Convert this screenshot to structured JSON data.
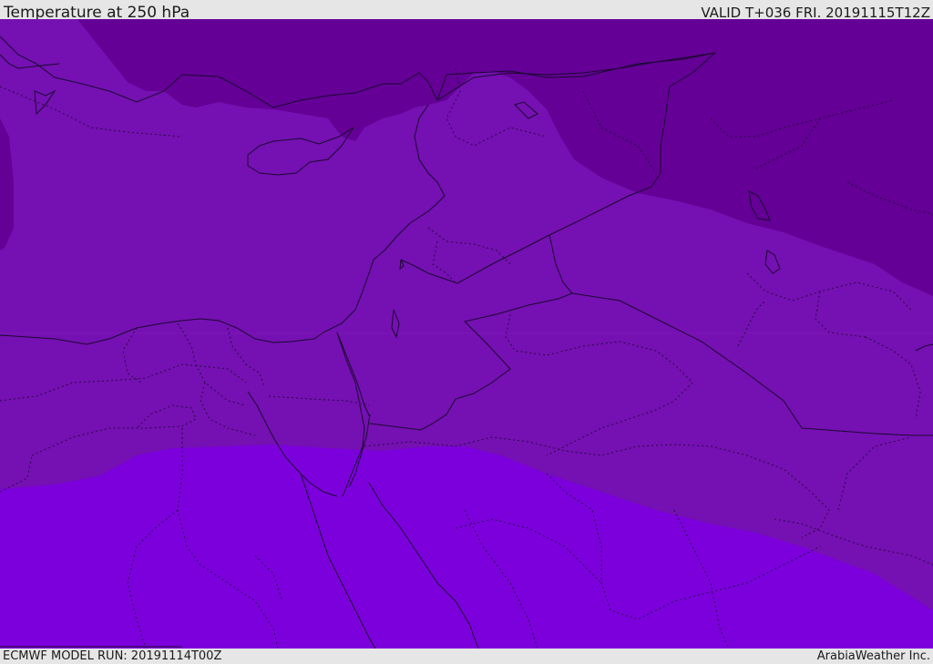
{
  "header": {
    "title": "Temperature at 250 hPa",
    "valid": "VALID T+036 FRI. 20191115T12Z"
  },
  "footer": {
    "model_run": "ECMWF MODEL RUN: 20191114T00Z",
    "credit": "ArabiaWeather Inc."
  },
  "map": {
    "region": "Eastern Mediterranean and Middle East",
    "temperature_bands": [
      {
        "level": "coldest",
        "color": "#640096"
      },
      {
        "level": "cold",
        "color": "#7510b2"
      },
      {
        "level": "milder",
        "color": "#7c00dc"
      }
    ],
    "line_colors": {
      "coast": "#1a0a30",
      "border": "#2a0a40"
    }
  }
}
